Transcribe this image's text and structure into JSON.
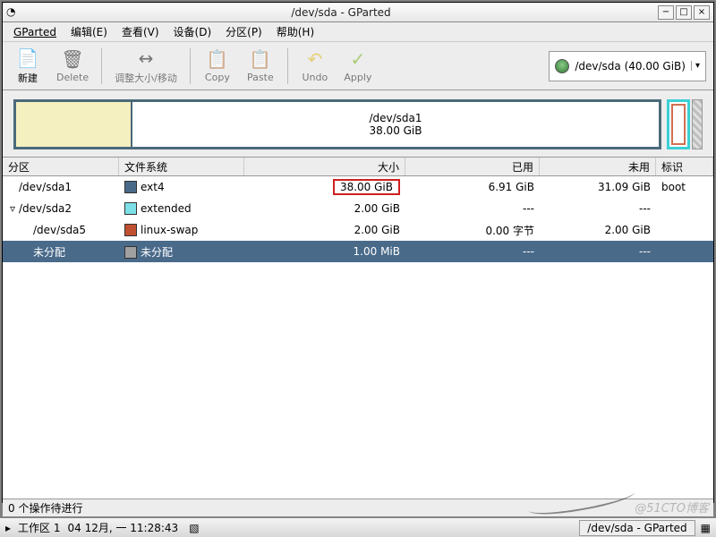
{
  "window": {
    "title": "/dev/sda - GParted"
  },
  "titlebar_buttons": {
    "min": "−",
    "max": "□",
    "close": "×"
  },
  "menu": {
    "gparted": "GParted",
    "edit": "编辑(E)",
    "view": "查看(V)",
    "device": "设备(D)",
    "partition": "分区(P)",
    "help": "帮助(H)"
  },
  "toolbar": {
    "new": "新建",
    "delete": "Delete",
    "resize": "调整大小/移动",
    "copy": "Copy",
    "paste": "Paste",
    "undo": "Undo",
    "apply": "Apply"
  },
  "device_selector": {
    "label": "/dev/sda  (40.00 GiB)",
    "arrow": "▾"
  },
  "viz": {
    "main_label": "/dev/sda1",
    "main_size": "38.00 GiB"
  },
  "columns": {
    "partition": "分区",
    "filesystem": "文件系统",
    "size": "大小",
    "used": "已用",
    "free": "未用",
    "flags": "标识"
  },
  "rows": [
    {
      "expander": "",
      "indent": 0,
      "part": "/dev/sda1",
      "swatch": "sw-ext4",
      "fs": "ext4",
      "size": "38.00 GiB",
      "size_hl": true,
      "used": "6.91 GiB",
      "free": "31.09 GiB",
      "flags": "boot",
      "selected": false
    },
    {
      "expander": "▿",
      "indent": 0,
      "part": "/dev/sda2",
      "swatch": "sw-extended",
      "fs": "extended",
      "size": "2.00 GiB",
      "size_hl": false,
      "used": "---",
      "free": "---",
      "flags": "",
      "selected": false
    },
    {
      "expander": "",
      "indent": 1,
      "part": "/dev/sda5",
      "swatch": "sw-swap",
      "fs": "linux-swap",
      "size": "2.00 GiB",
      "size_hl": false,
      "used": "0.00 字节",
      "free": "2.00 GiB",
      "flags": "",
      "selected": false
    },
    {
      "expander": "",
      "indent": 1,
      "part": "未分配",
      "swatch": "sw-unalloc",
      "fs": "未分配",
      "size": "1.00 MiB",
      "size_hl": false,
      "used": "---",
      "free": "---",
      "flags": "",
      "selected": true
    }
  ],
  "status": "0 个操作待进行",
  "taskbar": {
    "ws_arrow": "▸",
    "workspace": "工作区 1",
    "datetime": "04 12月, 一 11:28:43",
    "task": "/dev/sda - GParted"
  },
  "watermark": "@51CTO博客"
}
